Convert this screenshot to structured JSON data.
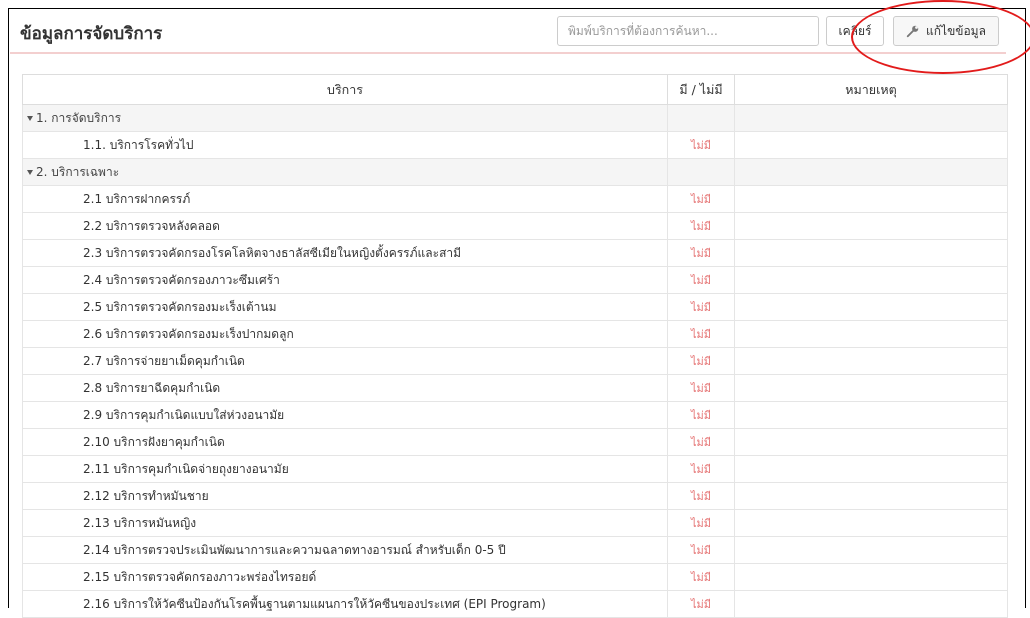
{
  "panel": {
    "title": "ข้อมูลการจัดบริการ",
    "search_placeholder": "พิมพ์บริการที่ต้องการค้นหา...",
    "clear_label": "เคลียร์",
    "edit_label": "แก้ไขข้อมูล"
  },
  "table": {
    "headers": [
      "บริการ",
      "มี / ไม่มี",
      "หมายเหตุ"
    ],
    "groups": [
      {
        "label": "1. การจัดบริการ",
        "rows": [
          {
            "name": "1.1. บริการโรคทั่วไป",
            "status": "ไม่มี",
            "note": ""
          }
        ]
      },
      {
        "label": "2. บริการเฉพาะ",
        "rows": [
          {
            "name": "2.1 บริการฝากครรภ์",
            "status": "ไม่มี",
            "note": ""
          },
          {
            "name": "2.2 บริการตรวจหลังคลอด",
            "status": "ไม่มี",
            "note": ""
          },
          {
            "name": "2.3 บริการตรวจคัดกรองโรคโลหิตจางธาลัสซีเมียในหญิงตั้งครรภ์และสามี",
            "status": "ไม่มี",
            "note": ""
          },
          {
            "name": "2.4 บริการตรวจคัดกรองภาวะซึมเศร้า",
            "status": "ไม่มี",
            "note": ""
          },
          {
            "name": "2.5 บริการตรวจคัดกรองมะเร็งเต้านม",
            "status": "ไม่มี",
            "note": ""
          },
          {
            "name": "2.6 บริการตรวจคัดกรองมะเร็งปากมดลูก",
            "status": "ไม่มี",
            "note": ""
          },
          {
            "name": "2.7 บริการจ่ายยาเม็ดคุมกำเนิด",
            "status": "ไม่มี",
            "note": ""
          },
          {
            "name": "2.8 บริการยาฉีดคุมกำเนิด",
            "status": "ไม่มี",
            "note": ""
          },
          {
            "name": "2.9 บริการคุมกำเนิดแบบใส่ห่วงอนามัย",
            "status": "ไม่มี",
            "note": ""
          },
          {
            "name": "2.10 บริการฝังยาคุมกำเนิด",
            "status": "ไม่มี",
            "note": ""
          },
          {
            "name": "2.11 บริการคุมกำเนิดจ่ายถุงยางอนามัย",
            "status": "ไม่มี",
            "note": ""
          },
          {
            "name": "2.12 บริการทำหมันชาย",
            "status": "ไม่มี",
            "note": ""
          },
          {
            "name": "2.13 บริการหมันหญิง",
            "status": "ไม่มี",
            "note": ""
          },
          {
            "name": "2.14 บริการตรวจประเมินพัฒนาการและความฉลาดทางอารมณ์ สำหรับเด็ก 0-5 ปี",
            "status": "ไม่มี",
            "note": ""
          },
          {
            "name": "2.15 บริการตรวจคัดกรองภาวะพร่องไทรอยด์",
            "status": "ไม่มี",
            "note": ""
          },
          {
            "name": "2.16 บริการให้วัคซีนป้องกันโรคพื้นฐานตามแผนการให้วัคซีนของประเทศ (EPI Program)",
            "status": "ไม่มี",
            "note": ""
          }
        ]
      }
    ]
  },
  "colors": {
    "status": "#e57373",
    "highlight_circle": "#e21b1b",
    "header_underline": "#f3cfcf"
  },
  "icons": {
    "edit": "wrench-icon",
    "group_toggle": "caret-down-icon"
  }
}
